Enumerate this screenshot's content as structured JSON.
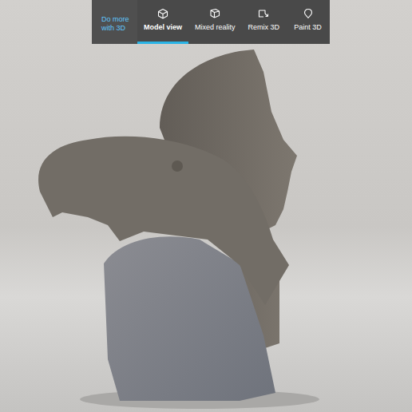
{
  "toolbar": {
    "promo": "Do more with 3D",
    "tabs": [
      {
        "label": "Model view",
        "selected": true,
        "icon": "cube"
      },
      {
        "label": "Mixed reality",
        "selected": false,
        "icon": "mixed"
      },
      {
        "label": "Remix 3D",
        "selected": false,
        "icon": "remix"
      },
      {
        "label": "Paint 3D",
        "selected": false,
        "icon": "paint"
      }
    ]
  }
}
